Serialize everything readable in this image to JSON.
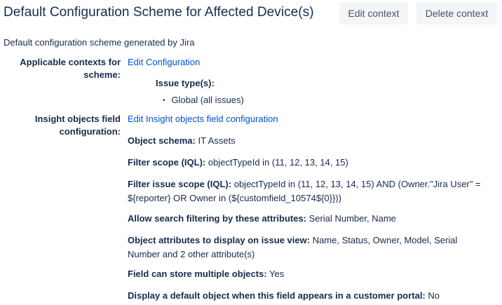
{
  "header": {
    "title": "Default Configuration Scheme for Affected Device(s)",
    "edit_context_label": "Edit context",
    "delete_context_label": "Delete context"
  },
  "description": "Default configuration scheme generated by Jira",
  "applicable_contexts": {
    "label": "Applicable contexts for scheme:",
    "link": "Edit Configuration",
    "issue_types_label": "Issue type(s):",
    "issue_types": [
      "Global (all issues)"
    ]
  },
  "insight_config": {
    "label": "Insight objects field configuration:",
    "link": "Edit Insight objects field configuration",
    "fields": [
      {
        "key": "Object schema:",
        "value": "IT Assets"
      },
      {
        "key": "Filter scope (IQL):",
        "value": "objectTypeId in (11, 12, 13, 14, 15)"
      },
      {
        "key": "Filter issue scope (IQL):",
        "value": "objectTypeId in (11, 12, 13, 14, 15) AND (Owner.\"Jira User\" = ${reporter} OR Owner in (${customfield_10574${0}}))"
      },
      {
        "key": "Allow search filtering by these attributes:",
        "value": "Serial Number, Name"
      },
      {
        "key": "Object attributes to display on issue view:",
        "value": "Name, Status, Owner, Model, Serial Number and 2 other attribute(s)"
      },
      {
        "key": "Field can store multiple objects:",
        "value": "Yes"
      },
      {
        "key": "Display a default object when this field appears in a customer portal:",
        "value": "No"
      }
    ]
  }
}
